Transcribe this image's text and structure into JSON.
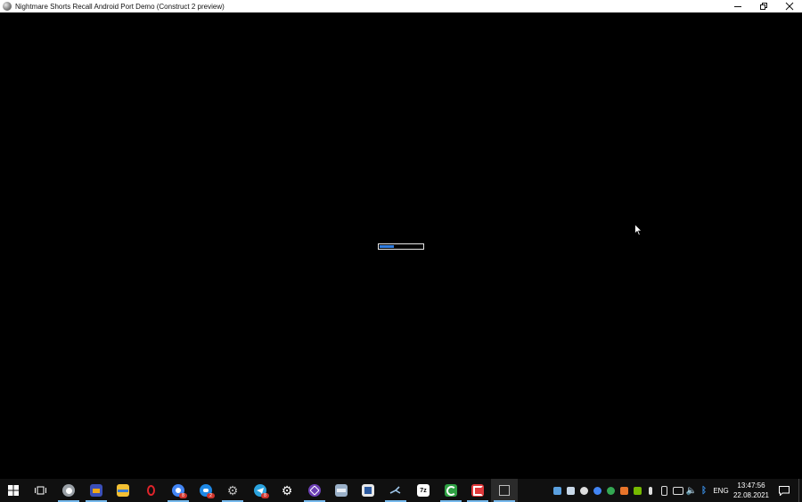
{
  "window": {
    "title": "Nightmare Shorts Recall Android Port Demo (Construct 2 preview)",
    "controls": [
      "minimize",
      "restore",
      "close"
    ]
  },
  "game": {
    "loading_progress": 0.32,
    "loader_fill_color": "#2f7de1",
    "loader_border_color": "#e8e8e8"
  },
  "taskbar": {
    "pinned": [
      {
        "name": "start-button",
        "icon": "windows-logo-icon"
      },
      {
        "name": "task-view-button",
        "icon": "task-view-icon"
      },
      {
        "name": "app-browser-gray",
        "icon": "circle-browser-icon",
        "running": true
      },
      {
        "name": "app-archive",
        "icon": "archive-icon",
        "running": true
      },
      {
        "name": "app-file-explorer",
        "icon": "folder-icon"
      },
      {
        "name": "app-opera",
        "icon": "opera-icon"
      },
      {
        "name": "app-chrome-profile",
        "icon": "chrome-icon",
        "running": true,
        "badge": "8"
      },
      {
        "name": "app-chat",
        "icon": "chat-icon",
        "badge": "2"
      },
      {
        "name": "app-settings-gear",
        "icon": "gear-icon",
        "running": true
      },
      {
        "name": "app-telegram",
        "icon": "telegram-icon",
        "badge": "8"
      },
      {
        "name": "app-settings",
        "icon": "settings-icon"
      },
      {
        "name": "app-visual-studio",
        "icon": "visual-studio-icon",
        "running": true
      },
      {
        "name": "app-disk-tool",
        "icon": "disk-icon"
      },
      {
        "name": "app-editor",
        "icon": "editor-icon"
      },
      {
        "name": "app-steam",
        "icon": "steam-icon",
        "running": true
      },
      {
        "name": "app-7zip",
        "icon": "7zip-icon",
        "label": "7z"
      },
      {
        "name": "app-green",
        "icon": "green-c-icon",
        "running": true
      },
      {
        "name": "app-construct",
        "icon": "construct-icon",
        "running": true
      },
      {
        "name": "app-game-window",
        "icon": "window-icon",
        "running": true,
        "active": true
      }
    ],
    "tray": {
      "language": "ENG",
      "time": "13:47:56",
      "date": "22.08.2021"
    }
  }
}
